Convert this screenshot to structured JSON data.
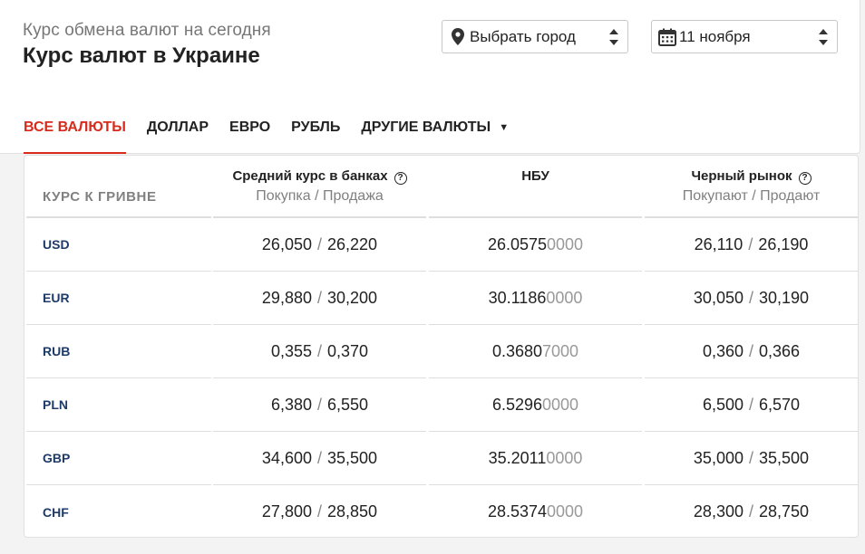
{
  "header": {
    "subtitle": "Курс обмена валют на сегодня",
    "title": "Курс валют в Украине"
  },
  "city_select": {
    "value": "Выбрать город",
    "icon": "map-pin-icon"
  },
  "date_select": {
    "value": "11 ноября",
    "icon": "calendar-icon"
  },
  "tabs": [
    {
      "label": "ВСЕ ВАЛЮТЫ",
      "active": true
    },
    {
      "label": "ДОЛЛАР",
      "active": false
    },
    {
      "label": "ЕВРО",
      "active": false
    },
    {
      "label": "РУБЛЬ",
      "active": false
    },
    {
      "label": "ДРУГИЕ ВАЛЮТЫ",
      "active": false,
      "dropdown": true
    }
  ],
  "table": {
    "col0": "КУРС К ГРИВНЕ",
    "col1": {
      "title": "Средний курс в банках",
      "sub": "Покупка / Продажа"
    },
    "col2": {
      "title": "НБУ"
    },
    "col3": {
      "title": "Черный рынок",
      "sub": "Покупают / Продают"
    },
    "rows": [
      {
        "code": "USD",
        "bank_buy": "26,050",
        "bank_sell": "26,220",
        "nbu_main": "26.0575",
        "nbu_tail": "0000",
        "black_buy": "26,110",
        "black_sell": "26,190"
      },
      {
        "code": "EUR",
        "bank_buy": "29,880",
        "bank_sell": "30,200",
        "nbu_main": "30.1186",
        "nbu_tail": "0000",
        "black_buy": "30,050",
        "black_sell": "30,190"
      },
      {
        "code": "RUB",
        "bank_buy": "0,355",
        "bank_sell": "0,370",
        "nbu_main": "0.3680",
        "nbu_tail": "7000",
        "black_buy": "0,360",
        "black_sell": "0,366"
      },
      {
        "code": "PLN",
        "bank_buy": "6,380",
        "bank_sell": "6,550",
        "nbu_main": "6.5296",
        "nbu_tail": "0000",
        "black_buy": "6,500",
        "black_sell": "6,570"
      },
      {
        "code": "GBP",
        "bank_buy": "34,600",
        "bank_sell": "35,500",
        "nbu_main": "35.2011",
        "nbu_tail": "0000",
        "black_buy": "35,000",
        "black_sell": "35,500"
      },
      {
        "code": "CHF",
        "bank_buy": "27,800",
        "bank_sell": "28,850",
        "nbu_main": "28.5374",
        "nbu_tail": "0000",
        "black_buy": "28,300",
        "black_sell": "28,750"
      }
    ]
  },
  "separator": "/",
  "colors": {
    "accent": "#d72b1c",
    "currency_code": "#1e3a68",
    "muted": "#808080"
  }
}
